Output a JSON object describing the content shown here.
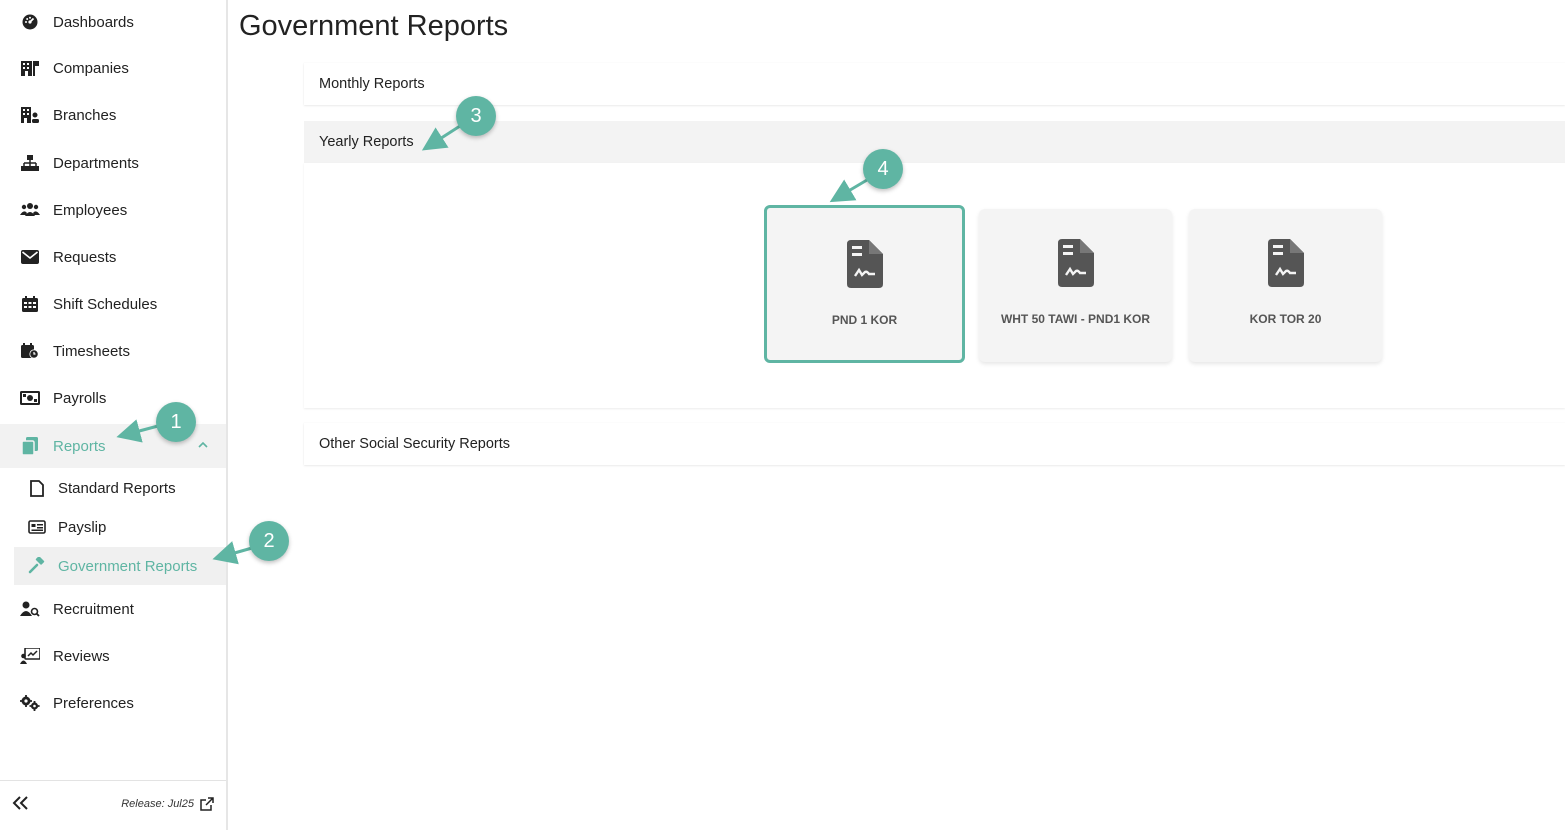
{
  "sidebar": {
    "items": [
      {
        "label": "Dashboards",
        "icon": "dashboard-icon"
      },
      {
        "label": "Companies",
        "icon": "building-icon"
      },
      {
        "label": "Branches",
        "icon": "branch-icon"
      },
      {
        "label": "Departments",
        "icon": "sitemap-icon"
      },
      {
        "label": "Employees",
        "icon": "users-icon"
      },
      {
        "label": "Requests",
        "icon": "envelope-icon"
      },
      {
        "label": "Shift Schedules",
        "icon": "calendar-icon"
      },
      {
        "label": "Timesheets",
        "icon": "calendar-clock-icon"
      },
      {
        "label": "Payrolls",
        "icon": "money-icon"
      },
      {
        "label": "Reports",
        "icon": "copy-icon"
      },
      {
        "label": "Recruitment",
        "icon": "user-search-icon"
      },
      {
        "label": "Reviews",
        "icon": "chart-board-icon"
      },
      {
        "label": "Preferences",
        "icon": "gears-icon"
      }
    ],
    "sub_items": [
      {
        "label": "Standard Reports",
        "icon": "file-icon"
      },
      {
        "label": "Payslip",
        "icon": "id-card-icon"
      },
      {
        "label": "Government Reports",
        "icon": "gavel-icon"
      }
    ],
    "footer": {
      "release": "Release: Jul25"
    }
  },
  "main": {
    "title": "Government Reports",
    "panels": [
      {
        "label": "Monthly Reports"
      },
      {
        "label": "Yearly Reports"
      },
      {
        "label": "Other Social Security Reports"
      }
    ],
    "cards": [
      {
        "label": "PND 1 KOR",
        "icon": "file-signature-icon"
      },
      {
        "label": "WHT 50 TAWI - PND1 KOR",
        "icon": "file-signature-icon"
      },
      {
        "label": "KOR TOR 20",
        "icon": "file-signature-icon"
      }
    ]
  },
  "annotations": [
    "1",
    "2",
    "3",
    "4"
  ],
  "colors": {
    "accent": "#5fb5a3",
    "card_bg": "#f4f4f4",
    "active_bg": "#f2f2f2"
  }
}
